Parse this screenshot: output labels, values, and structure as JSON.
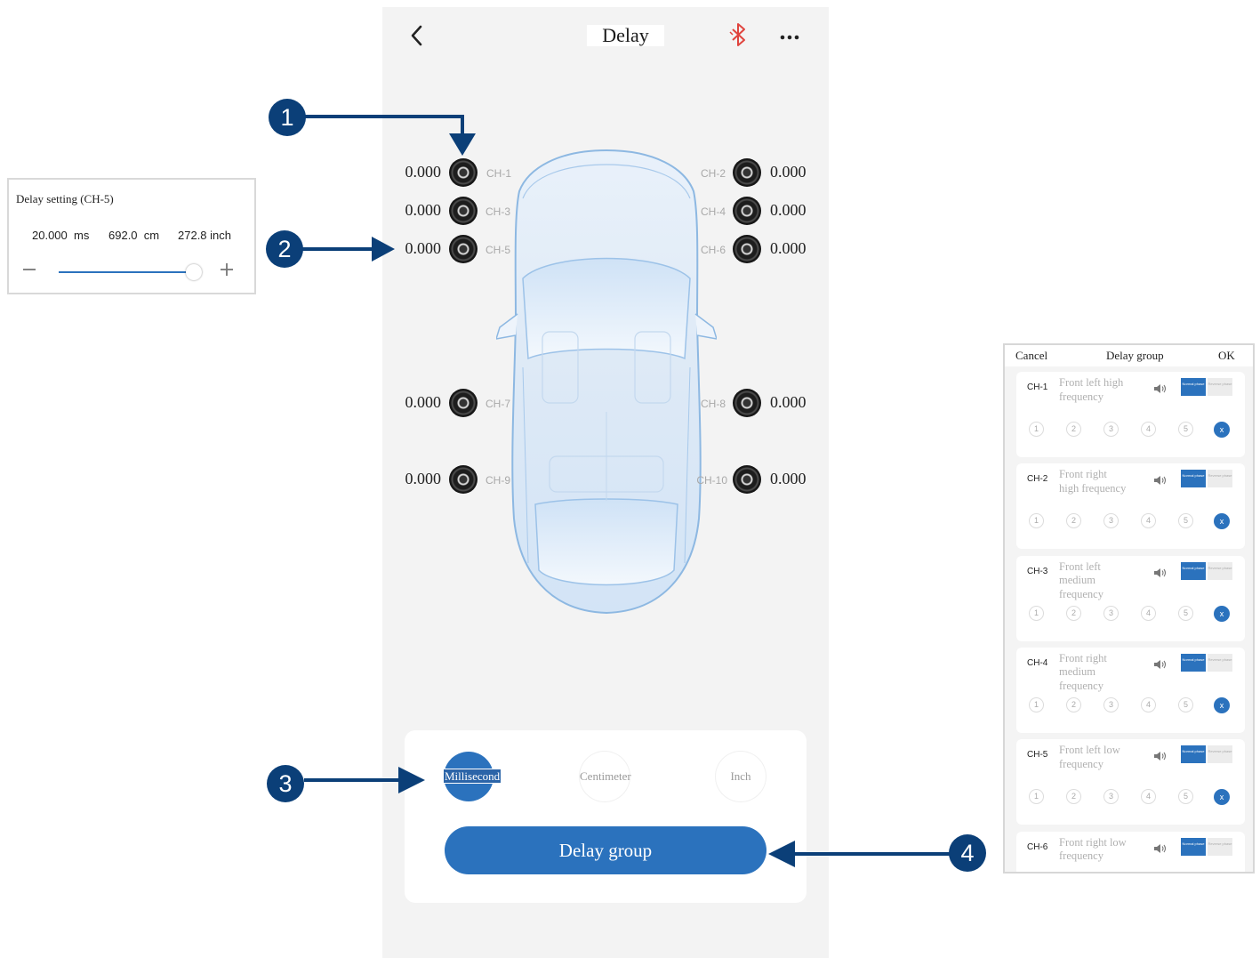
{
  "header": {
    "title": "Delay"
  },
  "channels_left": [
    {
      "channel": "CH-1",
      "value": "0.000"
    },
    {
      "channel": "CH-3",
      "value": "0.000"
    },
    {
      "channel": "CH-5",
      "value": "0.000"
    },
    {
      "channel": "CH-7",
      "value": "0.000"
    },
    {
      "channel": "CH-9",
      "value": "0.000"
    }
  ],
  "channels_right": [
    {
      "channel": "CH-2",
      "value": "0.000"
    },
    {
      "channel": "CH-4",
      "value": "0.000"
    },
    {
      "channel": "CH-6",
      "value": "0.000"
    },
    {
      "channel": "CH-8",
      "value": "0.000"
    },
    {
      "channel": "CH-10",
      "value": "0.000"
    }
  ],
  "units": {
    "millisecond": "Millisecond",
    "centimeter": "Centimeter",
    "inch": "Inch"
  },
  "delay_group_button": "Delay group",
  "delay_setting": {
    "title": "Delay setting (CH-5)",
    "ms_value": "20.000",
    "ms_unit": "ms",
    "cm_value": "692.0",
    "cm_unit": "cm",
    "inch_value": "272.8",
    "inch_unit": "inch",
    "slider_level": 0.95
  },
  "delay_group_panel": {
    "cancel": "Cancel",
    "title": "Delay group",
    "ok": "OK",
    "phase_normal": "Normal phase",
    "phase_reverse": "Reverse phase",
    "group_numbers": [
      "1",
      "2",
      "3",
      "4",
      "5"
    ],
    "clear": "x",
    "rows": [
      {
        "channel": "CH-1",
        "desc": "Front left high frequency"
      },
      {
        "channel": "CH-2",
        "desc": "Front right high frequency"
      },
      {
        "channel": "CH-3",
        "desc": "Front left medium frequency"
      },
      {
        "channel": "CH-4",
        "desc": "Front right medium frequency"
      },
      {
        "channel": "CH-5",
        "desc": "Front left low frequency"
      },
      {
        "channel": "CH-6",
        "desc": "Front right low frequency"
      }
    ]
  },
  "markers": [
    "1",
    "2",
    "3",
    "4"
  ],
  "colors": {
    "accent": "#2b72bd",
    "marker": "#0b3f78",
    "bluetooth": "#e0443e"
  }
}
